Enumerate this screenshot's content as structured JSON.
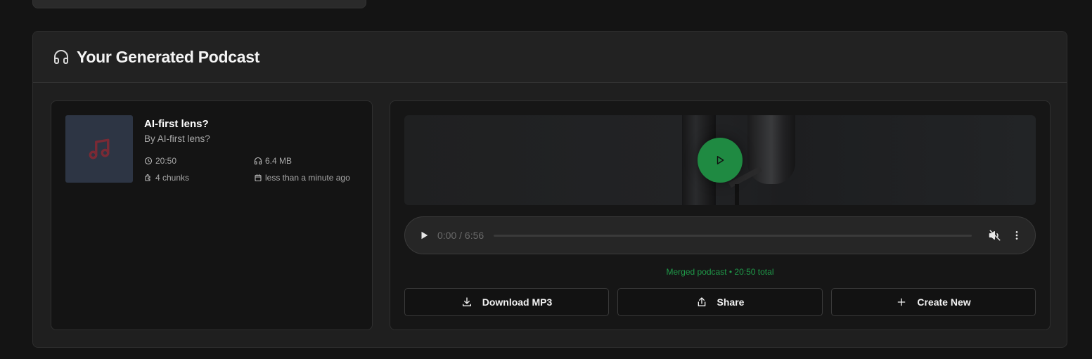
{
  "panel": {
    "title": "Your Generated Podcast",
    "icon": "headphones-icon"
  },
  "episode": {
    "title": "AI-first lens?",
    "author": "By AI-first lens?",
    "duration": "20:50",
    "size": "6.4 MB",
    "chunks": "4 chunks",
    "created": "less than a minute ago",
    "cover_icon": "music-note-icon"
  },
  "player": {
    "time": "0:00 / 6:56",
    "progress": 0,
    "muted": true,
    "status": "Merged podcast • 20:50 total"
  },
  "actions": {
    "download": "Download MP3",
    "share": "Share",
    "create": "Create New"
  },
  "colors": {
    "accent": "#1f8a42",
    "status_text": "#1f9a49",
    "cover_bg": "#2d3544",
    "cover_icon": "#7a2a35"
  }
}
